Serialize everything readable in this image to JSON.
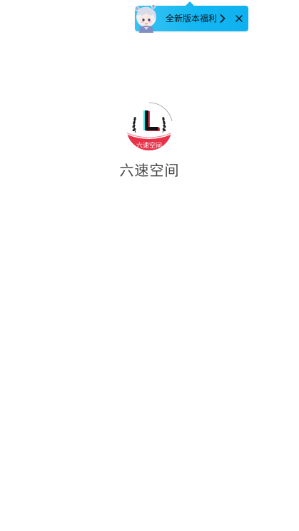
{
  "promo": {
    "text": "全新版本福利",
    "mascot_icon": "mascot-character",
    "chevron_icon": "chevron-right-icon",
    "close_icon": "close-icon",
    "background_color": "#13b7f2"
  },
  "app": {
    "logo_icon": "app-logo",
    "logo_text": "六速空间",
    "name": "六速空间"
  }
}
